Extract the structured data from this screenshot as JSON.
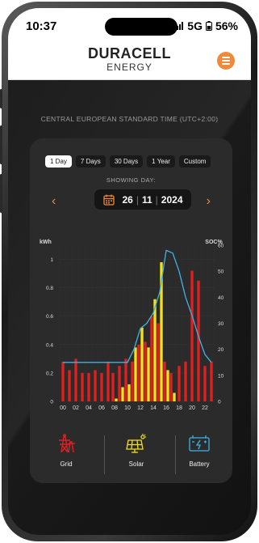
{
  "status": {
    "time": "10:37",
    "network": "5G",
    "battery": "56%"
  },
  "header": {
    "brand": "DURACELL",
    "brand_sub": "ENERGY"
  },
  "timezone": "CENTRAL EUROPEAN STANDARD TIME (UTC+2:00)",
  "tabs": [
    "1 Day",
    "7 Days",
    "30 Days",
    "1 Year",
    "Custom"
  ],
  "active_tab": "1 Day",
  "showing_label": "SHOWING DAY:",
  "date": {
    "day": "26",
    "month": "11",
    "year": "2024"
  },
  "legend": {
    "grid": "Grid",
    "solar": "Solar",
    "battery": "Battery"
  },
  "colors": {
    "accent": "#f08a3a",
    "grid": "#e02020",
    "solar": "#f2e020",
    "battery": "#3db3e6"
  },
  "chart_data": {
    "type": "bar",
    "left_axis_unit": "kWh",
    "right_axis_unit": "SOC%",
    "x_tick_labels": [
      "00",
      "02",
      "04",
      "06",
      "08",
      "10",
      "12",
      "14",
      "16",
      "18",
      "20",
      "22"
    ],
    "ylim": [
      0,
      1.1
    ],
    "y_ticks": [
      0,
      0.2,
      0.4,
      0.6,
      0.8,
      1
    ],
    "y2lim": [
      0,
      60
    ],
    "y2_ticks": [
      0,
      10,
      20,
      30,
      40,
      50,
      60
    ],
    "x_range": [
      0,
      24
    ],
    "grid": true,
    "series": [
      {
        "name": "Grid",
        "kind": "bar",
        "x": [
          0,
          1,
          2,
          3,
          4,
          5,
          6,
          7,
          8,
          9,
          10,
          11,
          12,
          13,
          14,
          15,
          16,
          17,
          18,
          19,
          20,
          21,
          22,
          23
        ],
        "values": [
          0.28,
          0.22,
          0.3,
          0.2,
          0.2,
          0.22,
          0.2,
          0.28,
          0.2,
          0.25,
          0.3,
          0.28,
          0.4,
          0.42,
          0.6,
          0.55,
          0.28,
          0.2,
          0.25,
          0.28,
          0.92,
          0.85,
          0.25,
          0.28
        ]
      },
      {
        "name": "Solar",
        "kind": "bar",
        "x": [
          8,
          9,
          10,
          11,
          12,
          13,
          14,
          15,
          16,
          17
        ],
        "values": [
          0.02,
          0.1,
          0.12,
          0.38,
          0.52,
          0.38,
          0.72,
          0.98,
          0.22,
          0.06
        ]
      },
      {
        "name": "Battery SOC",
        "kind": "line",
        "x": [
          0,
          2,
          4,
          6,
          8,
          10,
          11,
          12,
          13,
          14,
          15,
          16,
          17,
          18,
          19,
          20,
          21,
          22,
          23
        ],
        "values": [
          15,
          15,
          15,
          15,
          15,
          15,
          20,
          28,
          30,
          34,
          42,
          58,
          57,
          50,
          40,
          33,
          25,
          18,
          15
        ]
      }
    ]
  }
}
